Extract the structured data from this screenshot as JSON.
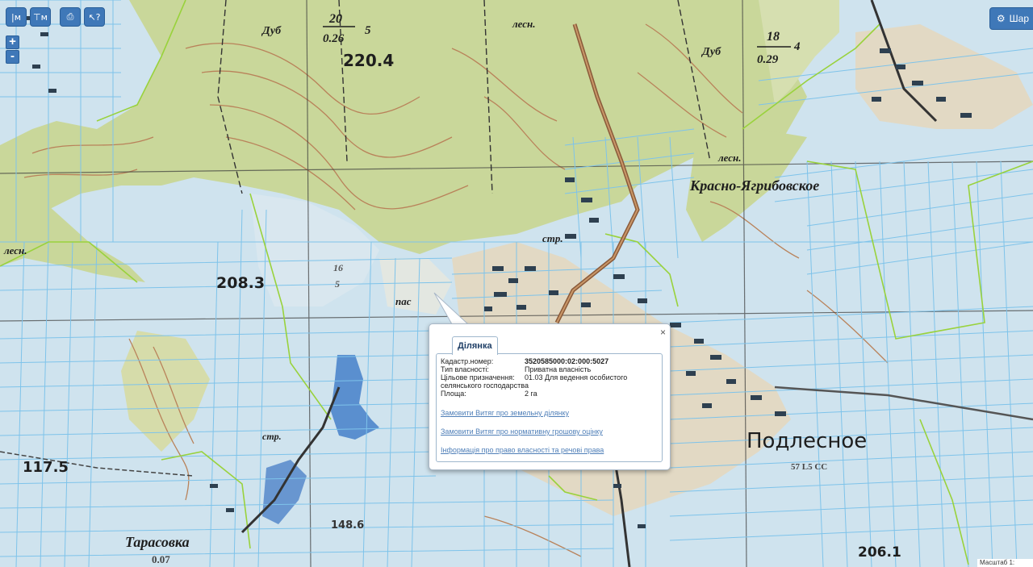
{
  "toolbar": {
    "buttons": [
      {
        "icon": "measure-line-icon",
        "glyph": "|м"
      },
      {
        "icon": "measure-area-icon",
        "glyph": "⊤м"
      },
      {
        "icon": "print-icon",
        "glyph": "⎙"
      },
      {
        "icon": "identify-icon",
        "glyph": "↖?"
      }
    ]
  },
  "zoom": {
    "in": "+",
    "out": "-"
  },
  "layers_button": {
    "label": "Шар"
  },
  "map_labels": {
    "dub1": "Дуб",
    "dub1_fr_top": "20",
    "dub1_fr_bot": "0.26",
    "dub1_tail": "5",
    "elev_220": "220.4",
    "dub2": "Дуб",
    "dub2_fr_top": "18",
    "dub2_fr_bot": "0.29",
    "dub2_tail": "4",
    "lesn1": "лесн.",
    "lesn2": "лесн.",
    "lesn3": "лесн.",
    "krasno": "Красно-Ягрибовское",
    "elev_208": "208.3",
    "frac_16": "16",
    "frac_5": "5",
    "pas": "пас",
    "str1": "стр.",
    "str2": "стр.",
    "podlesnoe": "Подлесное",
    "podlesnoe_sub": "57 L5 CC",
    "elev_117": "117.5",
    "tarasovka": "Тарасовка",
    "tarasovka_sub": "0.07",
    "elev_208_1": "206.1",
    "elev_148": "148.6"
  },
  "popup": {
    "tab_label": "Ділянка",
    "close_glyph": "×",
    "fields": [
      {
        "label": "Кадастр.номер:",
        "value": "3520585000:02:000:5027"
      },
      {
        "label": "Тип власності:",
        "value": "Приватна власність"
      },
      {
        "label": "Цільове призначення:",
        "value": "01.03 Для ведення особистого"
      },
      {
        "label": "Площа:",
        "value": "2 га"
      }
    ],
    "purpose_continuation": "селянського господарства",
    "links": [
      "Замовити Витяг про земельну ділянку",
      "Замовити Витяг про нормативну грошову оцінку",
      "Інформація про право власності та речові права"
    ]
  },
  "scale": {
    "label": "Масштаб 1:"
  },
  "colors": {
    "forest": "#c9d79a",
    "water_parcel": "#cfe3ee",
    "parcel_line": "#7ec3ea",
    "boundary": "#99d23c",
    "road": "#b9793f",
    "contour": "#b9825a",
    "button": "#3f78b8"
  }
}
